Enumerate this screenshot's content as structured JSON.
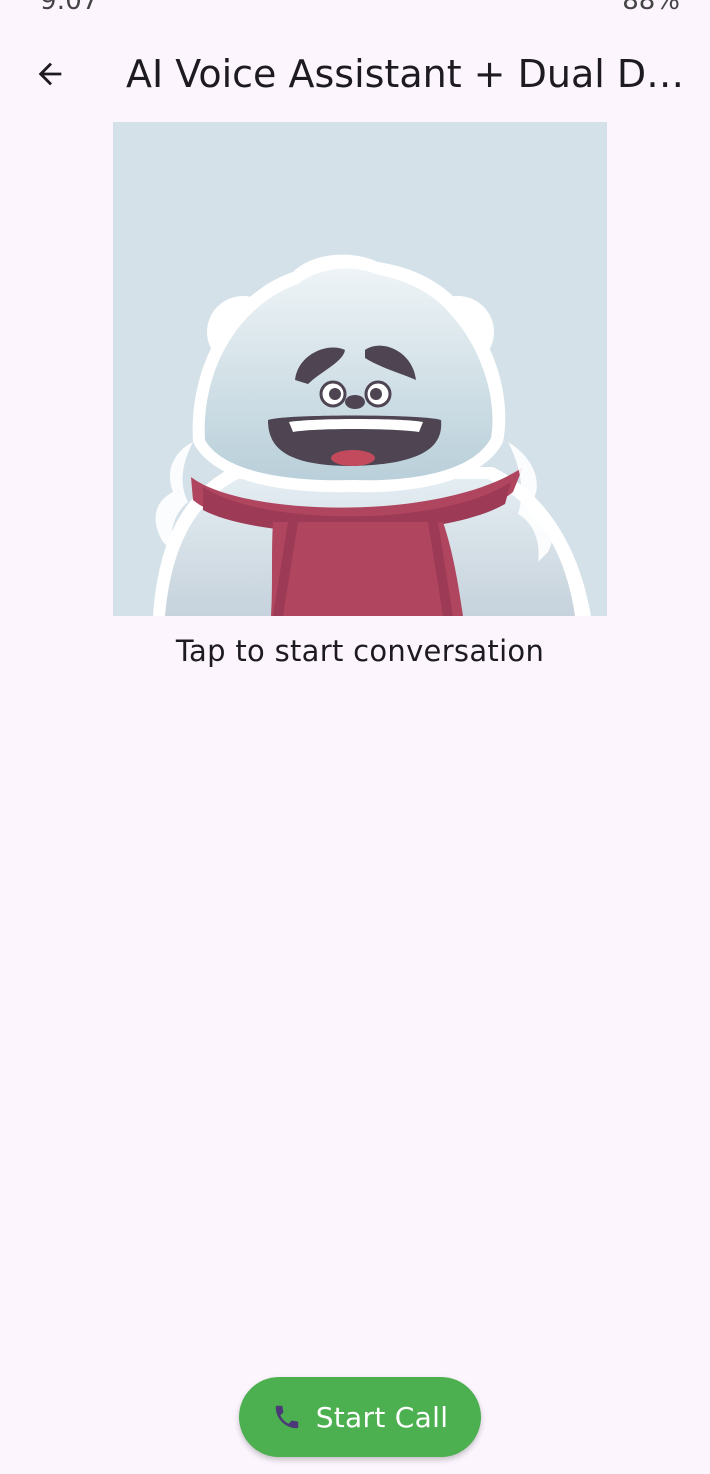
{
  "status_bar": {
    "time": "9:07",
    "battery": "88%"
  },
  "app_bar": {
    "title": "AI Voice Assistant + Dual De...",
    "back_icon": "arrow-left-icon"
  },
  "avatar": {
    "description_icon": "polar-bear-mascot",
    "background_color": "#d4e1e9",
    "scarf_color": "#b0455f"
  },
  "hint": {
    "text": "Tap to start conversation"
  },
  "call_button": {
    "label": "Start Call",
    "icon": "phone-icon",
    "color": "#4caf50"
  }
}
